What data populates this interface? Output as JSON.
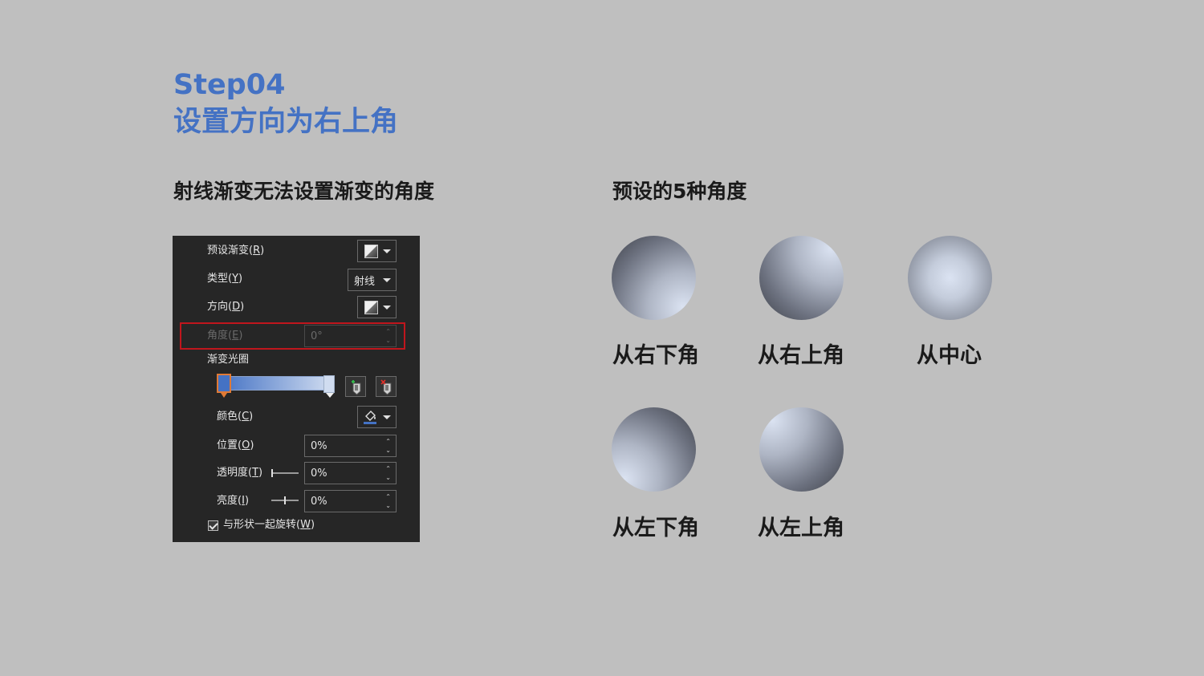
{
  "header": {
    "step": "Step04",
    "subtitle": "设置方向为右上角"
  },
  "left_caption": "射线渐变无法设置渐变的角度",
  "right_caption": "预设的5种角度",
  "panel": {
    "preset_gradient": {
      "label": "预设渐变",
      "key": "R"
    },
    "type": {
      "label": "类型",
      "key": "Y",
      "value": "射线"
    },
    "direction": {
      "label": "方向",
      "key": "D"
    },
    "angle": {
      "label": "角度",
      "key": "E",
      "value": "0°",
      "disabled": true
    },
    "gradient_stops": {
      "label": "渐变光圈",
      "stop_colors": [
        "#4472c4",
        "#d0dcf0"
      ]
    },
    "color": {
      "label": "颜色",
      "key": "C",
      "accent": "#4472c4"
    },
    "position": {
      "label": "位置",
      "key": "O",
      "value": "0%"
    },
    "transparency": {
      "label": "透明度",
      "key": "T",
      "value": "0%"
    },
    "brightness": {
      "label": "亮度",
      "key": "I",
      "value": "0%"
    },
    "rotate_with_shape": {
      "label": "与形状一起旋转",
      "key": "W",
      "checked": true
    }
  },
  "presets": [
    {
      "label": "从右下角",
      "gradient": "from-bottom-right"
    },
    {
      "label": "从右上角",
      "gradient": "from-top-right"
    },
    {
      "label": "从中心",
      "gradient": "from-center"
    },
    {
      "label": "从左下角",
      "gradient": "from-bottom-left"
    },
    {
      "label": "从左上角",
      "gradient": "from-top-left"
    }
  ],
  "colors": {
    "title": "#4472c4",
    "highlight_border": "#c0161d",
    "panel_bg": "#262626",
    "page_bg": "#bfbfbf"
  }
}
